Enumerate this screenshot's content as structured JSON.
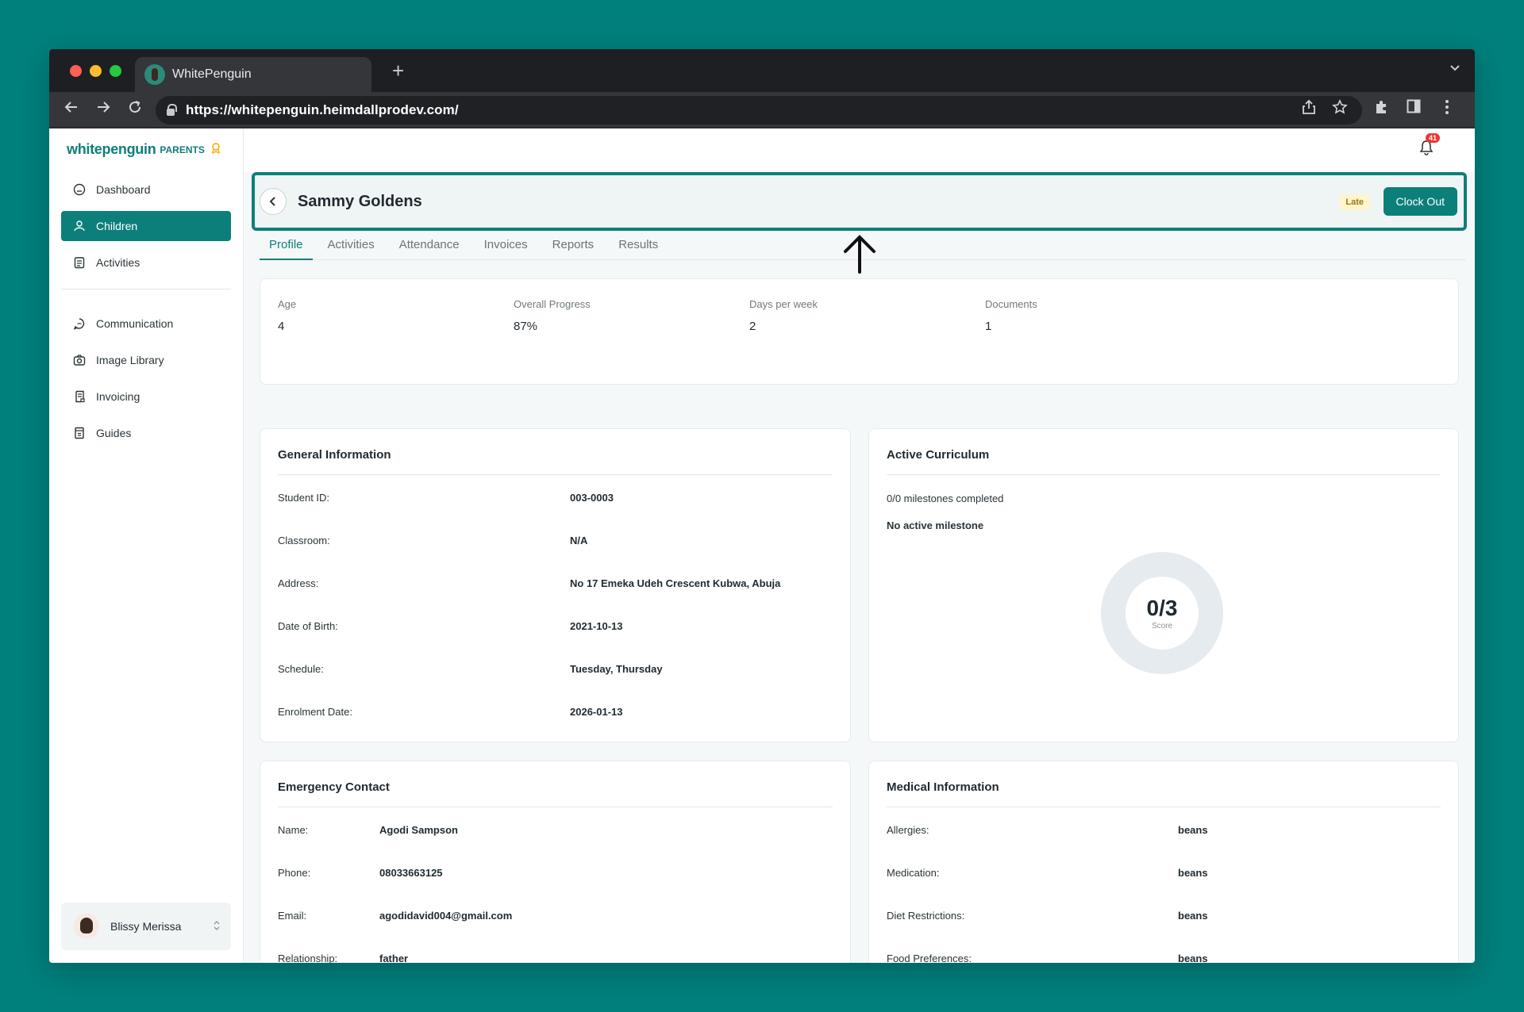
{
  "browser": {
    "tab_title": "WhitePenguin",
    "url": "https://whitepenguin.heimdallprodev.com/"
  },
  "brand": {
    "name": "whitepenguin",
    "sub": "PARENTS"
  },
  "sidebar": {
    "items": [
      {
        "label": "Dashboard",
        "icon": "dashboard-icon"
      },
      {
        "label": "Children",
        "icon": "children-icon",
        "active": true
      },
      {
        "label": "Activities",
        "icon": "activities-icon"
      },
      {
        "label": "Communication",
        "icon": "chat-icon"
      },
      {
        "label": "Image Library",
        "icon": "camera-icon"
      },
      {
        "label": "Invoicing",
        "icon": "invoice-icon"
      },
      {
        "label": "Guides",
        "icon": "guide-icon"
      }
    ],
    "user": "Blissy Merissa"
  },
  "notifications": {
    "count": "41"
  },
  "header": {
    "student_name": "Sammy Goldens",
    "status_badge": "Late",
    "clock_out": "Clock Out"
  },
  "tabs": [
    "Profile",
    "Activities",
    "Attendance",
    "Invoices",
    "Reports",
    "Results"
  ],
  "stats": [
    {
      "label": "Age",
      "value": "4"
    },
    {
      "label": "Overall Progress",
      "value": "87%"
    },
    {
      "label": "Days per week",
      "value": "2"
    },
    {
      "label": "Documents",
      "value": "1"
    }
  ],
  "general": {
    "title": "General Information",
    "rows": [
      {
        "label": "Student ID:",
        "value": "003-0003"
      },
      {
        "label": "Classroom:",
        "value": "N/A"
      },
      {
        "label": "Address:",
        "value": "No 17 Emeka Udeh Crescent Kubwa, Abuja"
      },
      {
        "label": "Date of Birth:",
        "value": "2021-10-13"
      },
      {
        "label": "Schedule:",
        "value": "Tuesday, Thursday"
      },
      {
        "label": "Enrolment Date:",
        "value": "2026-01-13"
      }
    ]
  },
  "curriculum": {
    "title": "Active Curriculum",
    "milestones": "0/0 milestones completed",
    "active": "No active milestone",
    "score": "0/3",
    "score_label": "Score"
  },
  "emergency": {
    "title": "Emergency Contact",
    "rows": [
      {
        "label": "Name:",
        "value": "Agodi Sampson"
      },
      {
        "label": "Phone:",
        "value": "08033663125"
      },
      {
        "label": "Email:",
        "value": "agodidavid004@gmail.com"
      },
      {
        "label": "Relationship:",
        "value": "father"
      }
    ]
  },
  "medical": {
    "title": "Medical Information",
    "rows": [
      {
        "label": "Allergies:",
        "value": "beans"
      },
      {
        "label": "Medication:",
        "value": "beans"
      },
      {
        "label": "Diet Restrictions:",
        "value": "beans"
      },
      {
        "label": "Food Preferences:",
        "value": "beans"
      }
    ]
  },
  "colors": {
    "brand": "#0d7f7a",
    "backdrop": "#00807d",
    "late": "#fff5cf"
  }
}
